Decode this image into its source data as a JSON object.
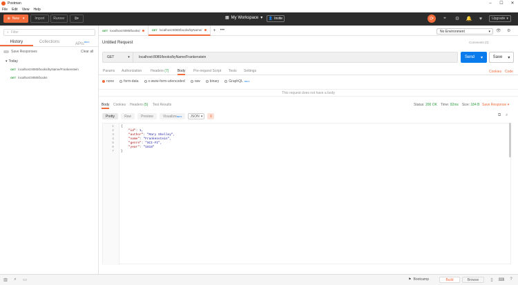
{
  "app": {
    "title": "Postman",
    "menu": [
      "File",
      "Edit",
      "View",
      "Help"
    ]
  },
  "header": {
    "new_label": "New",
    "import_label": "Import",
    "runner_label": "Runner",
    "workspace_label": "My Workspace",
    "invite_label": "Invite",
    "upgrade_label": "Upgrade"
  },
  "sidebar": {
    "filter_placeholder": "Filter",
    "tabs": [
      "History",
      "Collections",
      "APIs"
    ],
    "apis_badge": "BETA",
    "save_responses_label": "Save Responses",
    "clear_all_label": "Clear all",
    "group_label": "Today",
    "history_items": [
      {
        "method": "GET",
        "url": "localhost:8080/books/byName/Frankenstein"
      },
      {
        "method": "GET",
        "url": "localhost:8080/books"
      }
    ]
  },
  "request_tabs": [
    {
      "method": "GET",
      "label": "localhost:8080/books/"
    },
    {
      "method": "GET",
      "label": "localhost:8080/books/byName/"
    }
  ],
  "environment": {
    "selected": "No Environment"
  },
  "request": {
    "name": "Untitled Request",
    "comments_label": "Comments (0)",
    "method": "GET",
    "url": "localhost:8080/books/byName/Frankenstein",
    "send_label": "Send",
    "save_label": "Save",
    "subtabs": {
      "params": "Params",
      "authorization": "Authorization",
      "headers": "Headers",
      "headers_count": "(7)",
      "body": "Body",
      "prerequest": "Pre-request Script",
      "tests": "Tests",
      "settings": "Settings"
    },
    "cookies_label": "Cookies",
    "code_label": "Code",
    "body_options": [
      "none",
      "form-data",
      "x-www-form-urlencoded",
      "raw",
      "binary",
      "GraphQL"
    ],
    "graphql_badge": "BETA",
    "no_body_message": "This request does not have a body"
  },
  "response": {
    "tabs": {
      "body": "Body",
      "cookies": "Cookies",
      "headers": "Headers",
      "headers_count": "(5)",
      "test_results": "Test Results"
    },
    "status_label": "Status:",
    "status_value": "200 OK",
    "time_label": "Time:",
    "time_value": "92ms",
    "size_label": "Size:",
    "size_value": "184 B",
    "save_response_label": "Save Response",
    "view_modes": [
      "Pretty",
      "Raw",
      "Preview",
      "Visualize"
    ],
    "visualize_badge": "BETA",
    "format": "JSON",
    "lines": [
      {
        "n": "1",
        "text": "{"
      },
      {
        "n": "2",
        "key": "\"id\"",
        "value": "1,"
      },
      {
        "n": "3",
        "key": "\"author\"",
        "value": "\"Mary Shelley\","
      },
      {
        "n": "4",
        "key": "\"name\"",
        "value": "\"Frankenstein\","
      },
      {
        "n": "5",
        "key": "\"genre\"",
        "value": "\"SCI-FI\","
      },
      {
        "n": "6",
        "key": "\"year\"",
        "value": "\"1818\""
      },
      {
        "n": "7",
        "text": "}"
      }
    ]
  },
  "footer": {
    "bootcamp_label": "Bootcamp",
    "build_label": "Build",
    "browse_label": "Browse"
  },
  "colors": {
    "accent": "#f26b3a",
    "send": "#097bed",
    "header_bg": "#2c2c2c",
    "get": "#2a9d3b"
  }
}
